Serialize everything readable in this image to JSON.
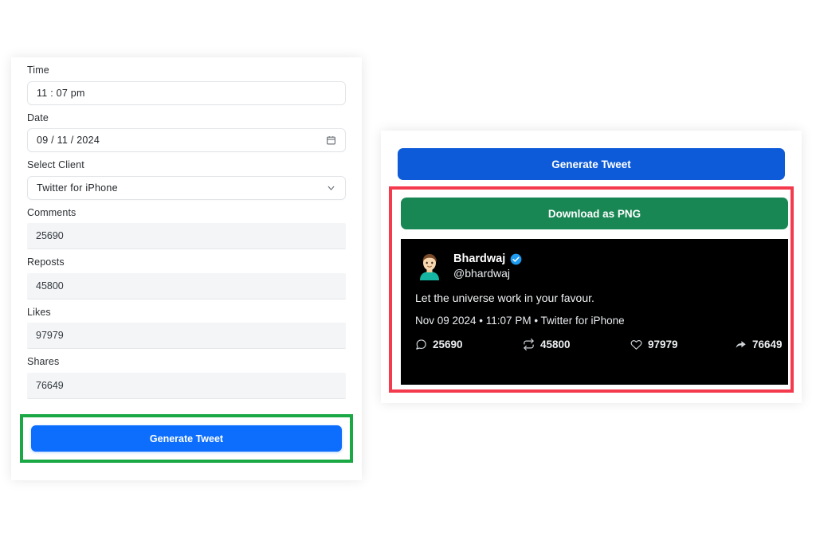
{
  "form": {
    "fields": [
      {
        "label": "Time",
        "value": "11 : 07   pm",
        "style": "outline",
        "icon": "none"
      },
      {
        "label": "Date",
        "value": "09 / 11 / 2024",
        "style": "outline",
        "icon": "calendar-icon"
      },
      {
        "label": "Select Client",
        "value": "Twitter for iPhone",
        "style": "outline",
        "icon": "chevron-down-icon"
      },
      {
        "label": "Comments",
        "value": "25690",
        "style": "filled",
        "icon": "none"
      },
      {
        "label": "Reposts",
        "value": "45800",
        "style": "filled",
        "icon": "none"
      },
      {
        "label": "Likes",
        "value": "97979",
        "style": "filled",
        "icon": "none"
      },
      {
        "label": "Shares",
        "value": "76649",
        "style": "filled",
        "icon": "none"
      }
    ],
    "generate_button_label": "Generate Tweet"
  },
  "preview": {
    "generate_button_label": "Generate Tweet",
    "download_button_label": "Download as PNG",
    "tweet": {
      "avatar": "person-emoji-avatar",
      "display_name": "Bhardwaj",
      "verified_icon": "verified-badge-icon",
      "handle": "@bhardwaj",
      "body": "Let the universe work in your favour.",
      "meta": "Nov 09 2024 • 11:07 PM • Twitter for iPhone",
      "stats": [
        {
          "icon": "comment-icon",
          "value": "25690"
        },
        {
          "icon": "repost-icon",
          "value": "45800"
        },
        {
          "icon": "like-icon",
          "value": "97979"
        },
        {
          "icon": "share-icon",
          "value": "76649"
        }
      ]
    }
  },
  "annotations": {
    "green_highlight_color": "#19a844",
    "red_highlight_color": "#f43b4e"
  },
  "colors": {
    "blue_primary": "#0d6efd",
    "blue_dark": "#0d5bd8",
    "green_success": "#198754",
    "card_background": "#ffffff",
    "tweet_background": "#000000"
  }
}
